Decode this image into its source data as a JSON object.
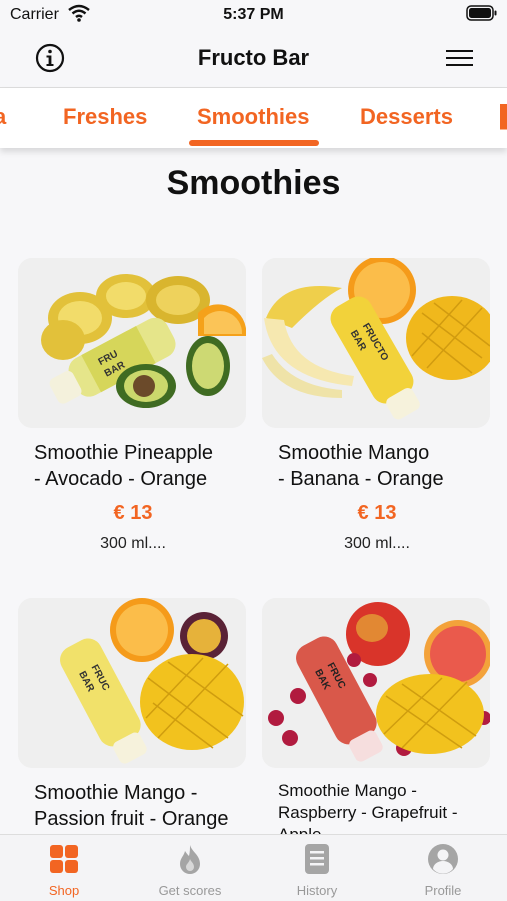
{
  "status_bar": {
    "carrier": "Carrier",
    "time": "5:37 PM"
  },
  "navbar": {
    "title": "Fructo Bar"
  },
  "categories": {
    "items": [
      "a",
      "Freshes",
      "Smoothies",
      "Desserts"
    ],
    "active": "Smoothies"
  },
  "section": {
    "title": "Smoothies"
  },
  "products": [
    {
      "name_line1": "Smoothie Pineapple",
      "name_line2": "- Avocado - Orange",
      "price": "€ 13",
      "desc": "300 ml...."
    },
    {
      "name_line1": "Smoothie Mango",
      "name_line2": "- Banana - Orange",
      "price": "€ 13",
      "desc": "300 ml...."
    },
    {
      "name_line1": "Smoothie Mango -",
      "name_line2": "Passion fruit - Orange"
    },
    {
      "name_line1": "Smoothie Mango -",
      "name_line2": "Raspberry - Grapefruit -",
      "name_line3": "Apple"
    }
  ],
  "tabbar": {
    "items": [
      {
        "label": "Shop",
        "icon": "shop-grid-icon"
      },
      {
        "label": "Get scores",
        "icon": "flame-icon"
      },
      {
        "label": "History",
        "icon": "history-list-icon"
      },
      {
        "label": "Profile",
        "icon": "profile-icon"
      }
    ]
  },
  "colors": {
    "accent": "#f26522",
    "inactive": "#999999",
    "background": "#f7f7f9"
  }
}
